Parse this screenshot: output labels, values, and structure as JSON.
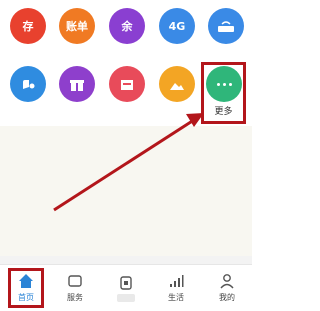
{
  "apps": {
    "row1": [
      {
        "name": "app-red",
        "text": "存",
        "color": "#e8412e"
      },
      {
        "name": "app-orange-bill",
        "text": "账单",
        "color": "#f07a23"
      },
      {
        "name": "app-purple-balance",
        "text": "余",
        "color": "#8a3fd1"
      },
      {
        "name": "app-4g",
        "text": "4G",
        "color": "#3a8ae6"
      },
      {
        "name": "app-router",
        "text": "",
        "color": "#3a8ae6"
      }
    ],
    "row2": [
      {
        "name": "app-blue",
        "text": "",
        "color": "#2f8ce0"
      },
      {
        "name": "app-purple-gift",
        "text": "",
        "color": "#8e3fcc"
      },
      {
        "name": "app-red-shop",
        "text": "",
        "color": "#e84b5a"
      },
      {
        "name": "app-orange-photo",
        "text": "",
        "color": "#f3a524"
      }
    ],
    "more": {
      "label": "更多",
      "color": "#2fb67a"
    }
  },
  "colors": {
    "highlight": "#b3161b",
    "active_tab": "#2b84d6"
  },
  "tabs": [
    {
      "label": "首页",
      "icon": "home-icon",
      "active": true
    },
    {
      "label": "服务",
      "icon": "service-icon",
      "active": false
    },
    {
      "label": "",
      "icon": "center-icon",
      "active": false
    },
    {
      "label": "生活",
      "icon": "signal-icon",
      "active": false
    },
    {
      "label": "我的",
      "icon": "user-icon",
      "active": false
    }
  ]
}
